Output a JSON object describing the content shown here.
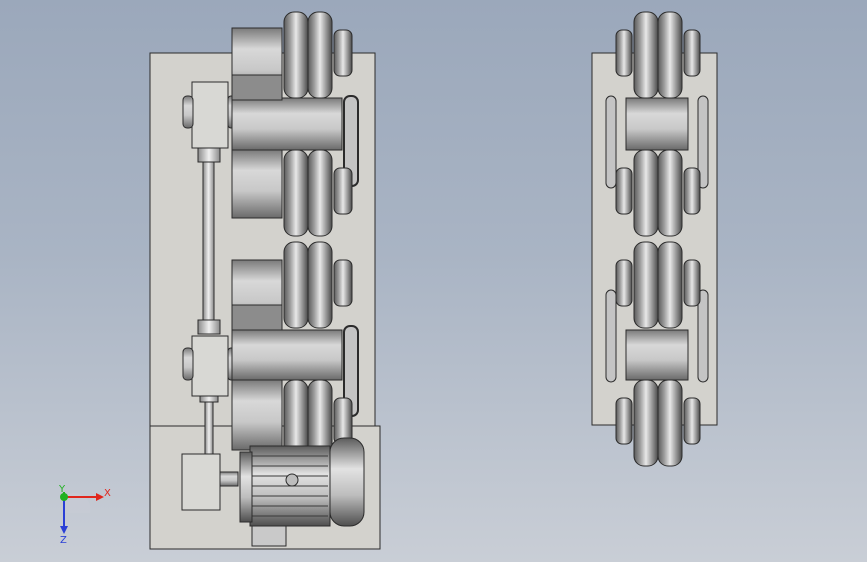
{
  "viewport": {
    "background_top": "#9ba8bb",
    "background_bottom": "#c9ced6"
  },
  "colors": {
    "plate": "#d3d2cd",
    "outline": "#2b2b2b",
    "roller_dark": "#6a6a6a",
    "roller_mid": "#b4b4b4",
    "roller_light": "#e6e6e6",
    "axis_x": "#e0261c",
    "axis_y": "#21b121",
    "axis_z": "#2a3fd6"
  },
  "triad": {
    "x_label": "X",
    "y_label": "Y",
    "z_label": "Z"
  },
  "icons": {
    "triad": "coordinate-axes-icon"
  }
}
